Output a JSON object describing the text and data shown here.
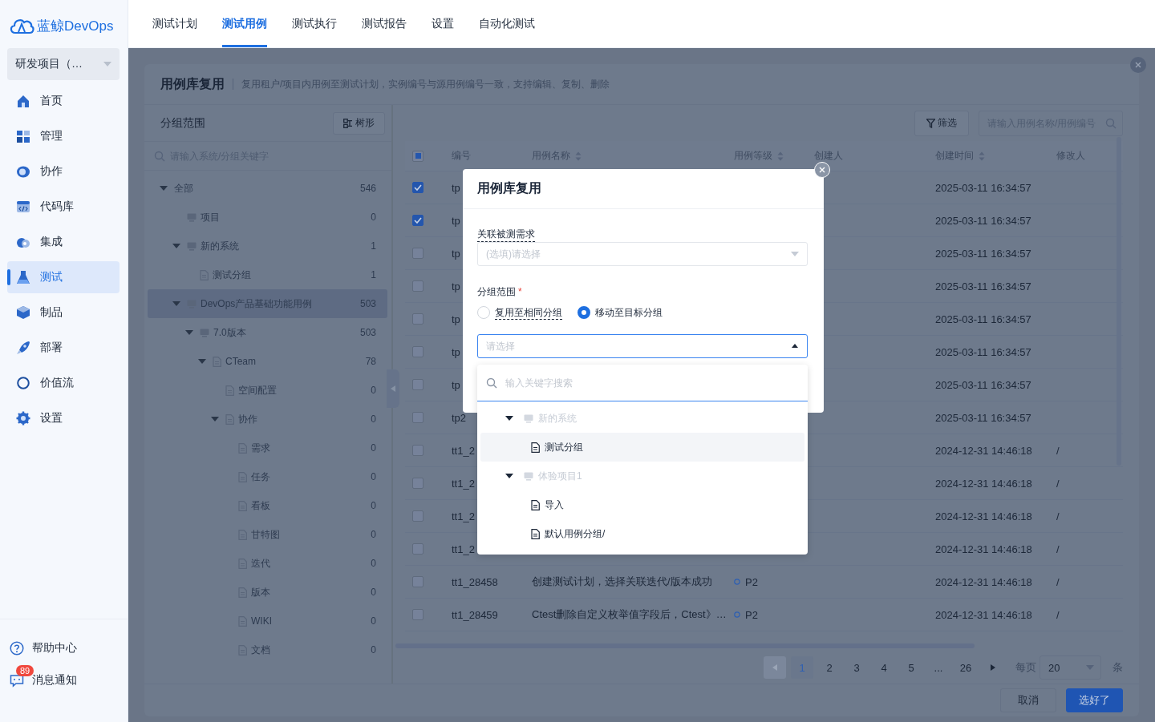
{
  "brand": {
    "name": "蓝鲸DevOps"
  },
  "project_selector": {
    "value": "研发项目（…"
  },
  "sidebar": {
    "items": [
      {
        "label": "首页",
        "selected": false
      },
      {
        "label": "管理",
        "selected": false
      },
      {
        "label": "协作",
        "selected": false
      },
      {
        "label": "代码库",
        "selected": false
      },
      {
        "label": "集成",
        "selected": false
      },
      {
        "label": "测试",
        "selected": true
      },
      {
        "label": "制品",
        "selected": false
      },
      {
        "label": "部署",
        "selected": false
      },
      {
        "label": "价值流",
        "selected": false
      },
      {
        "label": "设置",
        "selected": false
      }
    ],
    "footer": [
      {
        "label": "帮助中心"
      },
      {
        "label": "消息通知",
        "badge": "89"
      }
    ]
  },
  "top_tabs": [
    {
      "label": "测试计划",
      "selected": false
    },
    {
      "label": "测试用例",
      "selected": true
    },
    {
      "label": "测试执行",
      "selected": false
    },
    {
      "label": "测试报告",
      "selected": false
    },
    {
      "label": "设置",
      "selected": false
    },
    {
      "label": "自动化测试",
      "selected": false
    }
  ],
  "panel": {
    "title": "用例库复用",
    "description": "复用租户/项目内用例至测试计划，实例编号与源用例编号一致，支持编辑、复制、删除",
    "group_scope": {
      "title": "分组范围",
      "view_button": "树形",
      "search_placeholder": "请输入系统/分组关键字",
      "tree": [
        {
          "label": "全部",
          "count": "546",
          "expanded": true,
          "selected": false,
          "children": [
            {
              "label": "项目",
              "count": "0",
              "kind": "system",
              "selected": false
            },
            {
              "label": "新的系统",
              "count": "1",
              "kind": "system",
              "expanded": true,
              "selected": false,
              "children": [
                {
                  "label": "测试分组",
                  "count": "1",
                  "kind": "group",
                  "selected": false
                }
              ]
            },
            {
              "label": "DevOps产品基础功能用例",
              "count": "503",
              "kind": "system",
              "expanded": true,
              "selected": true,
              "children": [
                {
                  "label": "7.0版本",
                  "count": "503",
                  "kind": "system",
                  "expanded": true,
                  "selected": false,
                  "children": [
                    {
                      "label": "CTeam",
                      "count": "78",
                      "kind": "group",
                      "expanded": true,
                      "selected": false,
                      "children": [
                        {
                          "label": "空间配置",
                          "count": "0",
                          "kind": "group",
                          "selected": false
                        },
                        {
                          "label": "协作",
                          "count": "0",
                          "kind": "group",
                          "expanded": true,
                          "selected": false,
                          "children": [
                            {
                              "label": "需求",
                              "count": "0",
                              "kind": "group",
                              "selected": false
                            },
                            {
                              "label": "任务",
                              "count": "0",
                              "kind": "group",
                              "selected": false
                            },
                            {
                              "label": "看板",
                              "count": "0",
                              "kind": "group",
                              "selected": false
                            },
                            {
                              "label": "甘特图",
                              "count": "0",
                              "kind": "group",
                              "selected": false
                            },
                            {
                              "label": "迭代",
                              "count": "0",
                              "kind": "group",
                              "selected": false
                            },
                            {
                              "label": "版本",
                              "count": "0",
                              "kind": "group",
                              "selected": false
                            },
                            {
                              "label": "WIKI",
                              "count": "0",
                              "kind": "group",
                              "selected": false
                            },
                            {
                              "label": "文档",
                              "count": "0",
                              "kind": "group",
                              "selected": false
                            }
                          ]
                        }
                      ]
                    }
                  ]
                }
              ]
            }
          ]
        }
      ]
    },
    "toolbar": {
      "filter_button": "筛选",
      "search_placeholder": "请输入用例名称/用例编号"
    },
    "table": {
      "indeterminate": true,
      "columns": [
        {
          "label": "编号",
          "sortable": false
        },
        {
          "label": "用例名称",
          "sortable": true
        },
        {
          "label": "用例等级",
          "sortable": true
        },
        {
          "label": "创建人",
          "sortable": false
        },
        {
          "label": "创建时间",
          "sortable": true
        },
        {
          "label": "修改人",
          "sortable": false
        }
      ],
      "rows": [
        {
          "checked": true,
          "number": "tp",
          "created": "2025-03-11 16:34:57"
        },
        {
          "checked": true,
          "number": "tp",
          "created": "2025-03-11 16:34:57"
        },
        {
          "checked": false,
          "number": "tp",
          "created": "2025-03-11 16:34:57"
        },
        {
          "checked": false,
          "number": "tp",
          "created": "2025-03-11 16:34:57"
        },
        {
          "checked": false,
          "number": "tp",
          "created": "2025-03-11 16:34:57"
        },
        {
          "checked": false,
          "number": "tp",
          "created": "2025-03-11 16:34:57"
        },
        {
          "checked": false,
          "number": "tp",
          "created": "2025-03-11 16:34:57"
        },
        {
          "checked": false,
          "number": "tp2",
          "created": "2025-03-11 16:34:57"
        },
        {
          "checked": false,
          "number": "tt1_2",
          "created": "2024-12-31 14:46:18",
          "modifier": "/"
        },
        {
          "checked": false,
          "number": "tt1_2",
          "created": "2024-12-31 14:46:18",
          "modifier": "/"
        },
        {
          "checked": false,
          "number": "tt1_2",
          "created": "2024-12-31 14:46:18",
          "modifier": "/"
        },
        {
          "checked": false,
          "number": "tt1_2",
          "created": "2024-12-31 14:46:18",
          "modifier": "/"
        },
        {
          "checked": false,
          "number": "tt1_28458",
          "name": "创建测试计划，选择关联迭代/版本成功",
          "level": "P2",
          "created": "2024-12-31 14:46:18",
          "modifier": "/"
        },
        {
          "checked": false,
          "number": "tt1_28459",
          "name": "Ctest删除自定义枚举值字段后，Ctest》…",
          "level": "P2",
          "created": "2024-12-31 14:46:18",
          "modifier": "/"
        }
      ]
    },
    "pagination": {
      "prev_disabled": true,
      "next_disabled": false,
      "pages": [
        {
          "label": "1",
          "selected": true
        },
        {
          "label": "2",
          "selected": false
        },
        {
          "label": "3",
          "selected": false
        },
        {
          "label": "4",
          "selected": false
        },
        {
          "label": "5",
          "selected": false
        },
        {
          "label": "...",
          "selected": false
        },
        {
          "label": "26",
          "selected": false
        }
      ],
      "per_page_label": "每页",
      "page_size": "20",
      "unit": "条"
    },
    "buttons": [
      {
        "label": "取消",
        "kind": "secondary"
      },
      {
        "label": "选好了",
        "kind": "primary"
      }
    ]
  },
  "modal": {
    "title": "用例库复用",
    "requirement_field": {
      "label": "关联被测需求",
      "has_tooltip": true,
      "placeholder": "(选填)请选择"
    },
    "group_field": {
      "label": "分组范围",
      "required_mark": "*",
      "options": [
        {
          "label": "复用至相同分组",
          "selected": false,
          "has_tooltip": true
        },
        {
          "label": "移动至目标分组",
          "selected": true,
          "has_tooltip": false
        }
      ],
      "placeholder": "请选择",
      "expanded": true
    },
    "dropdown": {
      "search_placeholder": "输入关键字搜索",
      "items": [
        {
          "label": "新的系统",
          "kind": "system",
          "disabled": true,
          "expanded": true,
          "children": [
            {
              "label": "测试分组",
              "kind": "group",
              "highlighted": true
            }
          ]
        },
        {
          "label": "体验项目1",
          "kind": "system",
          "disabled": true,
          "expanded": true,
          "children": [
            {
              "label": "导入",
              "kind": "group",
              "highlighted": false
            },
            {
              "label": "默认用例分组/",
              "kind": "group",
              "highlighted": false
            }
          ]
        }
      ]
    }
  }
}
